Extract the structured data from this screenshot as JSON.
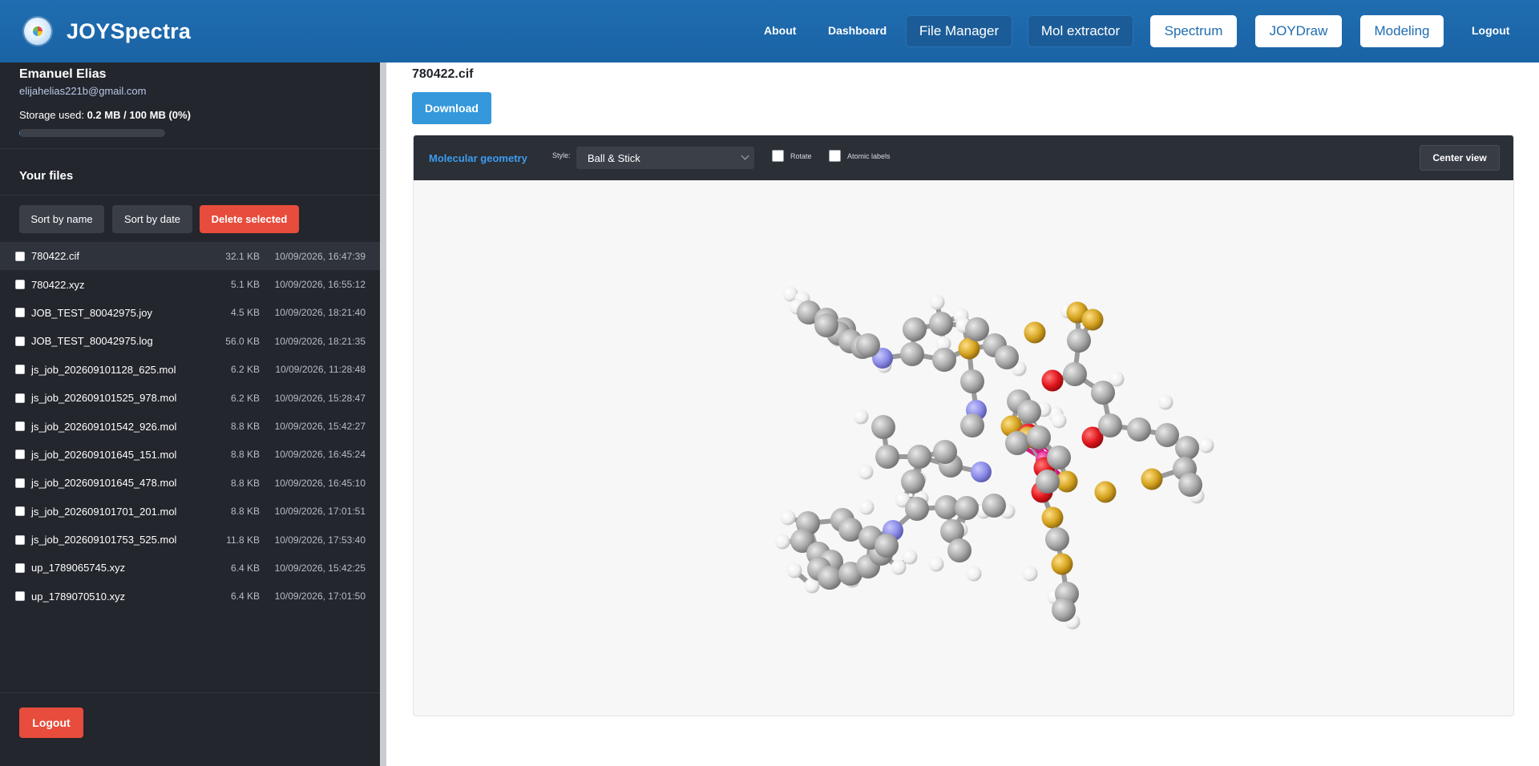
{
  "header": {
    "brand": "JOYSpectra",
    "nav": {
      "about": "About",
      "dashboard": "Dashboard",
      "file_manager": "File Manager",
      "mol_extractor": "Mol extractor",
      "spectrum": "Spectrum",
      "joydraw": "JOYDraw",
      "modeling": "Modeling",
      "logout": "Logout"
    }
  },
  "sidebar": {
    "user_name": "Emanuel Elias",
    "user_email": "elijahelias221b@gmail.com",
    "storage_label": "Storage used:",
    "storage_value": "0.2 MB / 100 MB (0%)",
    "storage_fraction": 0.002,
    "files_title": "Your files",
    "sort_by_name": "Sort by name",
    "sort_by_date": "Sort by date",
    "delete_selected": "Delete selected",
    "files": [
      {
        "name": "780422.cif",
        "size": "32.1 KB",
        "date": "10/09/2026, 16:47:39"
      },
      {
        "name": "780422.xyz",
        "size": "5.1 KB",
        "date": "10/09/2026, 16:55:12"
      },
      {
        "name": "JOB_TEST_80042975.joy",
        "size": "4.5 KB",
        "date": "10/09/2026, 18:21:40"
      },
      {
        "name": "JOB_TEST_80042975.log",
        "size": "56.0 KB",
        "date": "10/09/2026, 18:21:35"
      },
      {
        "name": "js_job_202609101128_625.mol",
        "size": "6.2 KB",
        "date": "10/09/2026, 11:28:48"
      },
      {
        "name": "js_job_202609101525_978.mol",
        "size": "6.2 KB",
        "date": "10/09/2026, 15:28:47"
      },
      {
        "name": "js_job_202609101542_926.mol",
        "size": "8.8 KB",
        "date": "10/09/2026, 15:42:27"
      },
      {
        "name": "js_job_202609101645_151.mol",
        "size": "8.8 KB",
        "date": "10/09/2026, 16:45:24"
      },
      {
        "name": "js_job_202609101645_478.mol",
        "size": "8.8 KB",
        "date": "10/09/2026, 16:45:10"
      },
      {
        "name": "js_job_202609101701_201.mol",
        "size": "8.8 KB",
        "date": "10/09/2026, 17:01:51"
      },
      {
        "name": "js_job_202609101753_525.mol",
        "size": "11.8 KB",
        "date": "10/09/2026, 17:53:40"
      },
      {
        "name": "up_1789065745.xyz",
        "size": "6.4 KB",
        "date": "10/09/2026, 15:42:25"
      },
      {
        "name": "up_1789070510.xyz",
        "size": "6.4 KB",
        "date": "10/09/2026, 17:01:50"
      }
    ],
    "logout": "Logout"
  },
  "main": {
    "file_title": "780422.cif",
    "download": "Download",
    "viewer": {
      "title": "Molecular geometry",
      "style_label": "Style:",
      "style_value": "Ball & Stick",
      "rotate_label": "Rotate",
      "atomic_labels_label": "Atomic labels",
      "center_view": "Center view"
    }
  },
  "colors": {
    "header": "#1f6db0",
    "sidebar": "#23262d",
    "accent_blue": "#3498db",
    "danger_red": "#e74c3c",
    "atom_carbon": "#a8a8a8",
    "atom_hydrogen": "#f2f2f2",
    "atom_nitrogen": "#8a8ae6",
    "atom_oxygen": "#e0151b",
    "atom_sulfur": "#d4a21e",
    "atom_metal": "#e0188a"
  }
}
